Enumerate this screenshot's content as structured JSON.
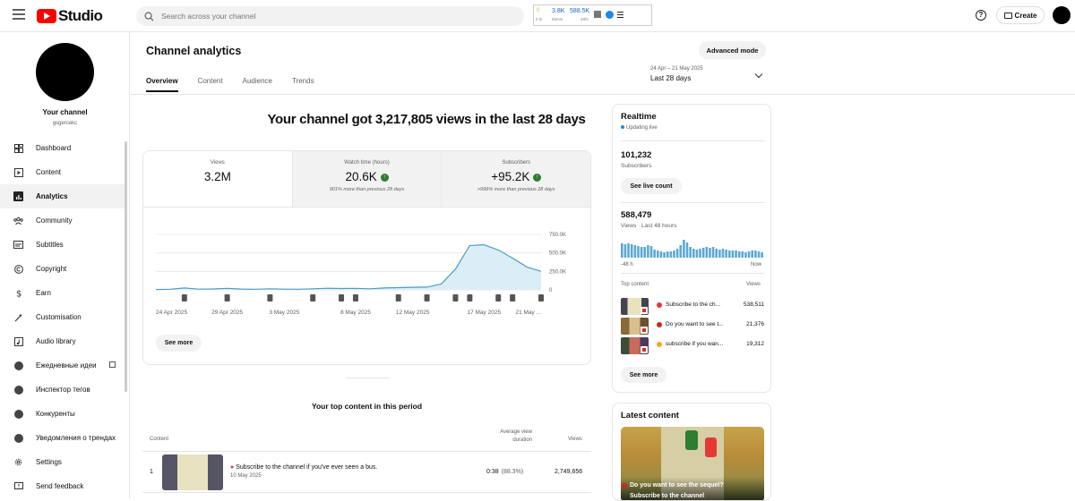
{
  "app": {
    "name": "Studio",
    "search_placeholder": "Search across your channel",
    "create_label": "Create",
    "help_glyph": "?"
  },
  "extension": {
    "a": "0",
    "a_sub": "0 hr",
    "b": "3.8K",
    "b_sub": "60min",
    "c": "588.5K",
    "c_sub": "48hr"
  },
  "channel": {
    "name": "Your channel",
    "handle": "gsgercekc"
  },
  "sidebar": {
    "items": [
      {
        "label": "Dashboard",
        "icon": "dashboard-icon"
      },
      {
        "label": "Content",
        "icon": "content-icon"
      },
      {
        "label": "Analytics",
        "icon": "analytics-icon",
        "active": true
      },
      {
        "label": "Community",
        "icon": "community-icon"
      },
      {
        "label": "Subtitles",
        "icon": "subtitles-icon"
      },
      {
        "label": "Copyright",
        "icon": "copyright-icon"
      },
      {
        "label": "Earn",
        "icon": "dollar-icon"
      },
      {
        "label": "Customisation",
        "icon": "wand-icon"
      },
      {
        "label": "Audio library",
        "icon": "audio-library-icon"
      },
      {
        "label": "Ежедневные идеи",
        "icon": "extension-icon"
      },
      {
        "label": "Инспектор тегов",
        "icon": "extension-icon"
      },
      {
        "label": "Конкуренты",
        "icon": "extension-icon"
      },
      {
        "label": "Уведомления о трендах",
        "icon": "extension-icon"
      },
      {
        "label": "Settings",
        "icon": "gear-icon"
      },
      {
        "label": "Send feedback",
        "icon": "feedback-icon"
      }
    ]
  },
  "main": {
    "title": "Channel analytics",
    "advanced_mode": "Advanced mode",
    "tabs": [
      "Overview",
      "Content",
      "Audience",
      "Trends"
    ],
    "date_range": {
      "dates": "24 Apr – 21 May 2025",
      "label": "Last 28 days"
    },
    "headline": "Your channel got 3,217,805 views in the last 28 days",
    "metrics": [
      {
        "label": "Views",
        "value": "3.2M",
        "change": ""
      },
      {
        "label": "Watch time (hours)",
        "value": "20.6K",
        "change": "901% more than previous 28 days"
      },
      {
        "label": "Subscribers",
        "value": "+95.2K",
        "change": ">999% more than previous 28 days"
      }
    ],
    "see_more": "See more",
    "top_content": {
      "title": "Your top content in this period",
      "col_content": "Content",
      "col_avg_line1": "Average view",
      "col_avg_line2": "duration",
      "col_views": "Views",
      "rows": [
        {
          "rank": "1",
          "title": "Subscribe to the channel if you've ever seen a bus.",
          "date": "10 May 2025",
          "duration": "0:38",
          "percent": "(88.3%)",
          "views": "2,749,656"
        }
      ]
    }
  },
  "chart_data": {
    "type": "area",
    "x_ticks": [
      "24 Apr 2025",
      "29 Apr 2025",
      "3 May 2025",
      "8 May 2025",
      "12 May 2025",
      "17 May 2025",
      "21 May ..."
    ],
    "y_ticks": [
      "750.0K",
      "500.0K",
      "250.0K",
      "0"
    ],
    "ylim": [
      0,
      750000
    ],
    "series": [
      {
        "values": [
          5000,
          8000,
          25000,
          10000,
          12000,
          20000,
          11000,
          8000,
          15000,
          10000,
          9000,
          15000,
          22000,
          18000,
          20000,
          15000,
          25000,
          30000,
          35000,
          38000,
          80000,
          280000,
          600000,
          610000,
          540000,
          430000,
          310000,
          250000
        ]
      }
    ],
    "color": "#4a9bc9",
    "fill": "#dbeef7",
    "grid": true
  },
  "realtime": {
    "title": "Realtime",
    "status": "Updating live",
    "subscribers_value": "101,232",
    "subscribers_label": "Subscribers",
    "see_live_count": "See live count",
    "views_value": "588,479",
    "views_label": "Views · Last 48 hours",
    "axis_start": "-48 h",
    "axis_end": "Now",
    "bars": [
      16,
      15,
      16,
      15,
      14,
      13,
      12,
      12,
      14,
      13,
      9,
      8,
      7,
      6,
      7,
      7,
      8,
      10,
      14,
      20,
      17,
      12,
      10,
      9,
      10,
      11,
      12,
      11,
      12,
      10,
      9,
      10,
      9,
      8,
      8,
      8,
      7,
      7,
      6,
      7,
      8,
      8,
      7,
      6
    ],
    "top_content_label": "Top content",
    "views_col_label": "Views",
    "top": [
      {
        "title": "Subscribe to the ch...",
        "views": "538,511",
        "emoji_color": "#e53935"
      },
      {
        "title": "Do you want to see t...",
        "views": "21,376",
        "emoji_color": "#c62828"
      },
      {
        "title": "subscribe if you wan...",
        "views": "19,312",
        "emoji_color": "#f4a825"
      }
    ],
    "see_more": "See more"
  },
  "latest": {
    "title": "Latest content",
    "caption_line1": "Do you want to see the sequel?",
    "caption_line2": "Subscribe to the channel"
  }
}
